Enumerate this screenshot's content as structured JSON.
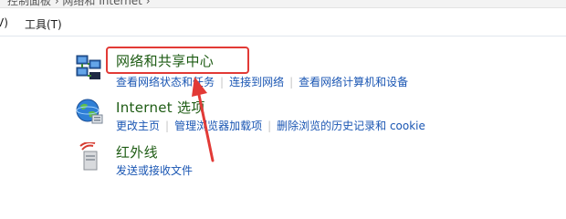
{
  "breadcrumb": {
    "text": "控制面板 › 网络和 Internet ›"
  },
  "menu": {
    "view_label": "V)",
    "tools_label": "工具(T)"
  },
  "categories": [
    {
      "title": "网络和共享中心",
      "icon": "network-sharing-icon",
      "links": [
        "查看网络状态和任务",
        "连接到网络",
        "查看网络计算机和设备"
      ]
    },
    {
      "title": "Internet 选项",
      "icon": "globe-internet-icon",
      "links": [
        "更改主页",
        "管理浏览器加载项",
        "删除浏览的历史记录和 cookie"
      ]
    },
    {
      "title": "红外线",
      "icon": "infrared-device-icon",
      "links": [
        "发送或接收文件"
      ]
    }
  ],
  "colors": {
    "category_title": "#1e5c14",
    "link": "#1a56b3",
    "annotation": "#e23a36"
  }
}
